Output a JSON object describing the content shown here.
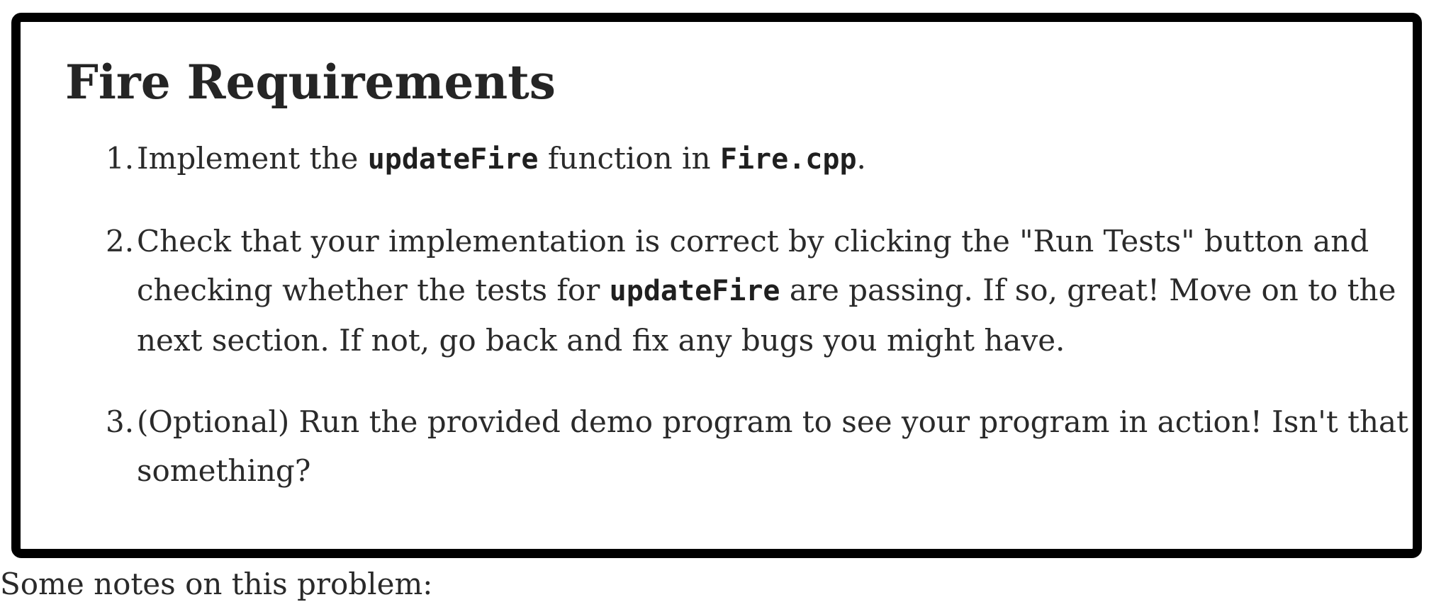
{
  "title": "Fire Requirements",
  "requirements": [
    {
      "number": "1.",
      "parts": [
        "Implement the ",
        "updateFire",
        " function in ",
        "Fire.cpp",
        "."
      ]
    },
    {
      "number": "2.",
      "parts": [
        "Check that your implementation is correct by clicking the \"Run Tests\" button and checking whether the tests for ",
        "updateFire",
        " are passing. If so, great! Move on to the next section. If not, go back and fix any bugs you might have."
      ]
    },
    {
      "number": "3.",
      "parts": [
        "(Optional) Run the provided demo program to see your program in action! Isn't that something?"
      ]
    }
  ],
  "footer_text": "Some notes on this problem:"
}
